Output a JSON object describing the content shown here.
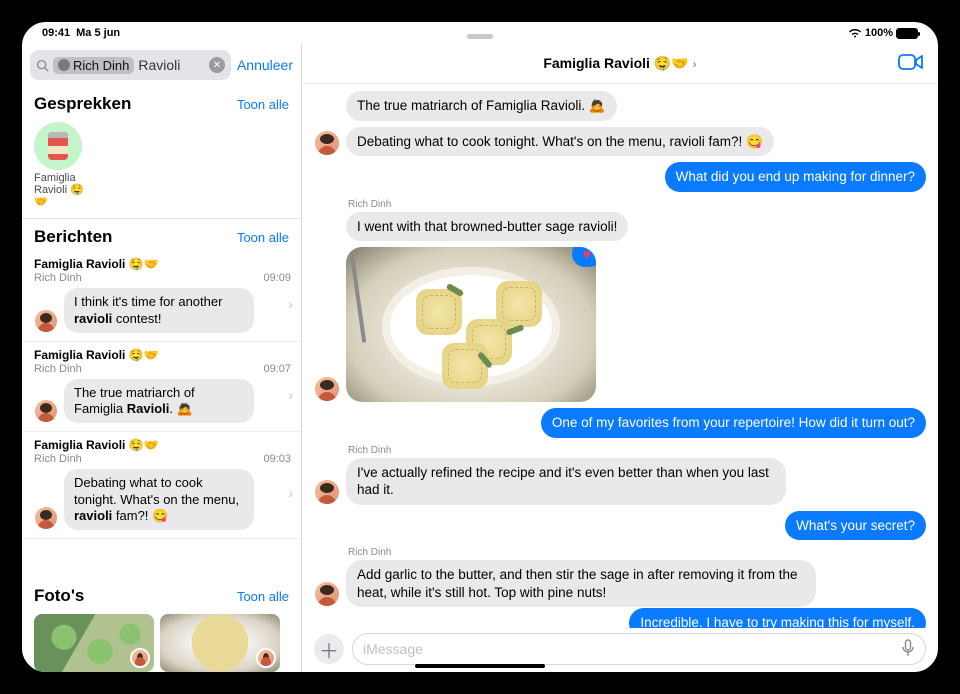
{
  "status": {
    "time": "09:41",
    "date": "Ma 5 jun",
    "battery": "100%"
  },
  "search": {
    "chip": "Rich Dinh",
    "query": "Ravioli",
    "cancel": "Annuleer"
  },
  "sections": {
    "conversations": {
      "title": "Gesprekken",
      "show_all": "Toon alle"
    },
    "messages": {
      "title": "Berichten",
      "show_all": "Toon alle"
    },
    "photos": {
      "title": "Foto's",
      "show_all": "Toon alle"
    }
  },
  "convo_result": {
    "line1": "Famiglia",
    "line2": "Ravioli 🤤🤝"
  },
  "msg_results": [
    {
      "chat": "Famiglia Ravioli 🤤🤝",
      "sender": "Rich Dinh",
      "time": "09:09",
      "pre": "I think it's time for another ",
      "hl": "ravioli",
      "post": " contest!"
    },
    {
      "chat": "Famiglia Ravioli 🤤🤝",
      "sender": "Rich Dinh",
      "time": "09:07",
      "pre": "The true matriarch of Famiglia ",
      "hl": "Ravioli",
      "post": ". 🙇"
    },
    {
      "chat": "Famiglia Ravioli 🤤🤝",
      "sender": "Rich Dinh",
      "time": "09:03",
      "pre": "Debating what to cook tonight. What's on the menu, ",
      "hl": "ravioli",
      "post": " fam?! 😋"
    }
  ],
  "chat": {
    "title": "Famiglia Ravioli 🤤🤝",
    "composer_placeholder": "iMessage",
    "thread": {
      "m1": "The true matriarch of Famiglia Ravioli. 🙇",
      "m2": "Debating what to cook tonight. What's on the menu, ravioli fam?! 😋",
      "m3": "What did you end up making for dinner?",
      "s4": "Rich Dinh",
      "m4": "I went with that browned-butter sage ravioli!",
      "m5": "One of my favorites from your repertoire! How did it turn out?",
      "s6": "Rich Dinh",
      "m6": "I've actually refined the recipe and it's even better than when you last had it.",
      "m7": "What's your secret?",
      "s8": "Rich Dinh",
      "m8": "Add garlic to the butter, and then stir the sage in after removing it from the heat, while it's still hot. Top with pine nuts!",
      "m9": "Incredible. I have to try making this for myself."
    }
  }
}
